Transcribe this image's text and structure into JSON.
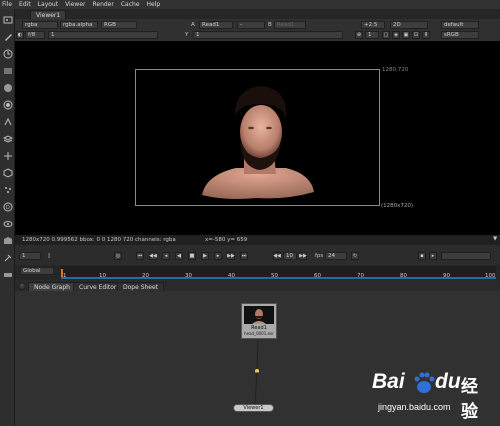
{
  "menu": [
    "File",
    "Edit",
    "Layout",
    "Viewer",
    "Render",
    "Cache",
    "Help"
  ],
  "viewer_tab": "Viewer1",
  "controls": {
    "channels": "rgba",
    "alpha": "rgba.alpha",
    "display": "RGB",
    "input_a_label": "A",
    "input_a": "Read1",
    "minus": "-",
    "input_b_label": "B",
    "input_b": "Read1",
    "gain": "+2.5",
    "view_mode": "2D",
    "lut": "default",
    "fstop": "f/8",
    "frame_field": "1",
    "y_label": "Y",
    "y_value": "1",
    "proxy": "1",
    "colorspace": "sRGB"
  },
  "viewer": {
    "format_top": "1280,720",
    "format_bottom": "(1280x720)",
    "info": "1280x720  0.999562  bbox: 0 0 1280 720  channels: rgba",
    "coords": "x=-580 y= 659"
  },
  "playback": {
    "frame": "1",
    "step": "10",
    "fps_label": "fps",
    "fps": "24"
  },
  "timeline": {
    "range_mode": "Global",
    "ticks": [
      "1",
      "10",
      "20",
      "30",
      "40",
      "50",
      "60",
      "70",
      "80",
      "90",
      "100"
    ]
  },
  "node_tabs": [
    "Node Graph",
    "Curve Editor",
    "Dope Sheet"
  ],
  "nodes": {
    "read_label": "Read1",
    "read_file": "head_0001.exr",
    "viewer_label": "Viewer1"
  },
  "watermark": {
    "brand": "Bai",
    "brand2": "du",
    "cn": "经验",
    "url": "jingyan.baidu.com"
  },
  "colors": {
    "accent_orange": "#e07020",
    "timeline_blue": "#1f6f9f",
    "baidu_blue": "#2f6fd8"
  }
}
